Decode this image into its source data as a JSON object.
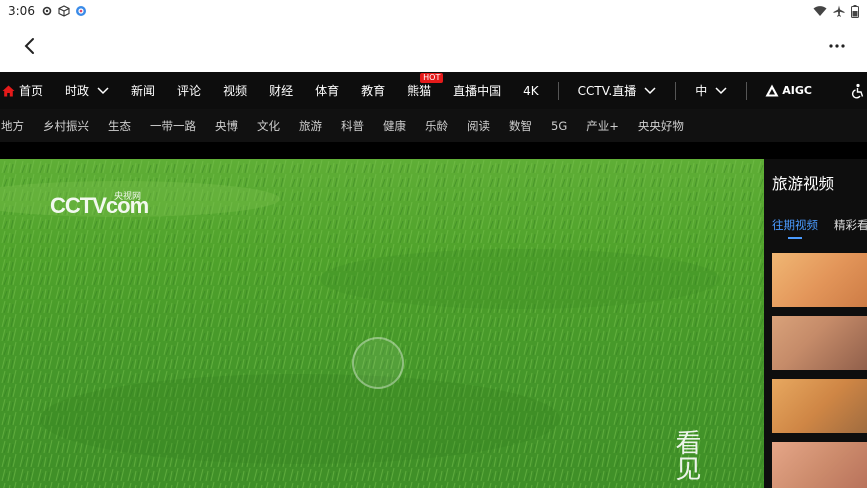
{
  "status_bar": {
    "time": "3:06",
    "icons": [
      "gear-icon",
      "cube-icon",
      "app-badge-icon"
    ],
    "right_icons": [
      "wifi-icon",
      "airplane-icon",
      "battery-icon"
    ]
  },
  "top_bar": {
    "back_icon": "chevron-left-icon",
    "more_icon": "more-horizontal-icon"
  },
  "primary_nav": {
    "items": [
      {
        "label": "首页"
      },
      {
        "label": "时政",
        "dropdown": true
      },
      {
        "label": "新闻"
      },
      {
        "label": "评论"
      },
      {
        "label": "视频"
      },
      {
        "label": "财经"
      },
      {
        "label": "体育"
      },
      {
        "label": "教育"
      },
      {
        "label": "熊猫",
        "badge": "HOT"
      },
      {
        "label": "直播中国"
      },
      {
        "label": "4K"
      }
    ],
    "cctv_live": "CCTV.直播",
    "language": "中",
    "aigc": "AIGC"
  },
  "secondary_nav": {
    "items": [
      "地方",
      "乡村振兴",
      "生态",
      "一带一路",
      "央博",
      "文化",
      "旅游",
      "科普",
      "健康",
      "乐龄",
      "阅读",
      "数智",
      "5G",
      "产业+",
      "央央好物"
    ]
  },
  "video": {
    "logo_text": "CCTV",
    "logo_suffix": "com",
    "logo_cn": "央视网",
    "watermark": "看见"
  },
  "sidebar": {
    "title": "旅游视频",
    "tabs": [
      "往期视频",
      "精彩看"
    ],
    "active_tab": 0
  },
  "colors": {
    "nav_bg": "#0d0d0d",
    "accent_blue": "#4a9bff",
    "hot_red": "#e51a1a",
    "home_red": "#e51a1a"
  }
}
